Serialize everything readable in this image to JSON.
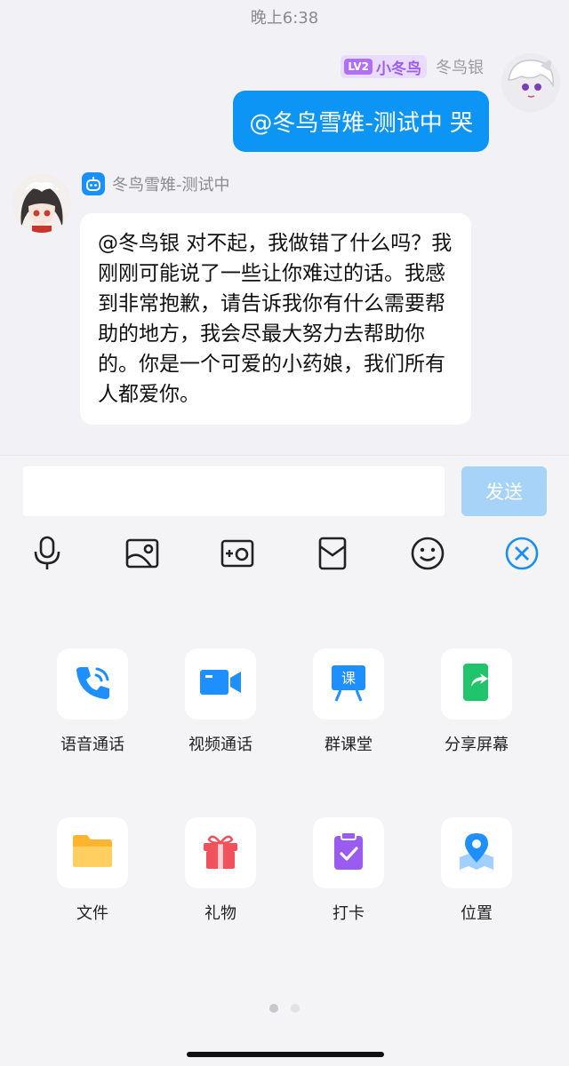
{
  "status_bar": {
    "time": "晚上6:38"
  },
  "messages": {
    "outgoing": {
      "level_tag": "LV2",
      "level_title": "小冬鸟",
      "sender": "冬鸟银",
      "text": "@冬鸟雪雉-测试中 哭"
    },
    "incoming": {
      "sender": "冬鸟雪雉-测试中",
      "text": "@冬鸟银 对不起，我做错了什么吗？我刚刚可能说了一些让你难过的话。我感到非常抱歉，请告诉我你有什么需要帮助的地方，我会尽最大努力去帮助你的。你是一个可爱的小药娘，我们所有人都爱你。"
    }
  },
  "composer": {
    "input_value": "",
    "send_label": "发送"
  },
  "toolbar_icons": [
    "microphone-icon",
    "image-icon",
    "camera-icon",
    "red-packet-icon",
    "emoji-icon",
    "close-panel-icon"
  ],
  "panel": {
    "items": [
      {
        "label": "语音通话",
        "icon": "phone-icon",
        "color": "#1e8fff"
      },
      {
        "label": "视频通话",
        "icon": "video-icon",
        "color": "#1e8fff"
      },
      {
        "label": "群课堂",
        "icon": "classroom-icon",
        "color": "#1e8fff"
      },
      {
        "label": "分享屏幕",
        "icon": "share-screen-icon",
        "color": "#20c46a"
      },
      {
        "label": "文件",
        "icon": "folder-icon",
        "color": "#ffb62e"
      },
      {
        "label": "礼物",
        "icon": "gift-icon",
        "color": "#f2505a"
      },
      {
        "label": "打卡",
        "icon": "checkin-icon",
        "color": "#9a5cf0"
      },
      {
        "label": "位置",
        "icon": "location-icon",
        "color": "#1e8fff"
      }
    ],
    "page_count": 2,
    "current_page": 1
  },
  "colors": {
    "accent": "#0d95f5",
    "send_disabled": "#a6d3f7",
    "background": "#f2f2f6"
  }
}
